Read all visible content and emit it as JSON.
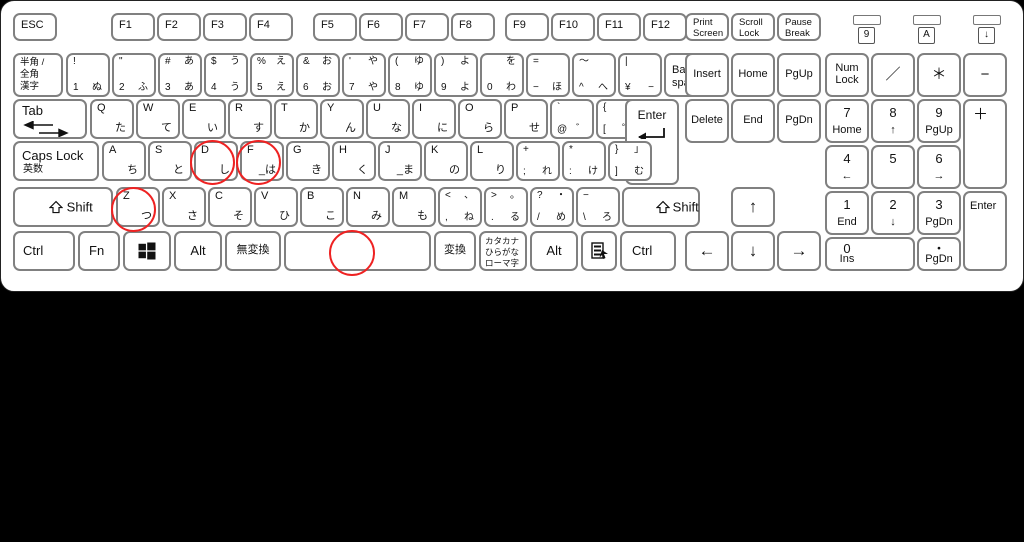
{
  "keyboard": {
    "layout_name": "Japanese JIS 109-key full-size keyboard",
    "highlight_color": "#ee2222",
    "case_color": "#ffffff",
    "key_border_color": "#808080",
    "background_color": "#000000"
  },
  "indicators": [
    {
      "name": "num-lock-led",
      "glyph": "9"
    },
    {
      "name": "caps-lock-led",
      "glyph": "A"
    },
    {
      "name": "scroll-lock-led",
      "glyph": "↓"
    }
  ],
  "function_row": {
    "esc": "ESC",
    "f_keys": [
      "F1",
      "F2",
      "F3",
      "F4",
      "F5",
      "F6",
      "F7",
      "F8",
      "F9",
      "F10",
      "F11",
      "F12"
    ],
    "print_screen": [
      "Print",
      "Screen"
    ],
    "scroll_lock": [
      "Scroll",
      "Lock"
    ],
    "pause_break": [
      "Pause",
      "Break"
    ]
  },
  "number_row": [
    {
      "name": "hankaku-zenkaku",
      "lines": [
        "半角 /",
        "全角",
        "漢字"
      ]
    },
    {
      "name": "key-1",
      "tl": "!",
      "tr": "",
      "bl": "1",
      "br": "ぬ"
    },
    {
      "name": "key-2",
      "tl": "\"",
      "tr": "",
      "bl": "2",
      "br": "ふ"
    },
    {
      "name": "key-3",
      "tl": "#",
      "tr": "あ",
      "bl": "3",
      "br": "あ"
    },
    {
      "name": "key-4",
      "tl": "$",
      "tr": "う",
      "bl": "4",
      "br": "う"
    },
    {
      "name": "key-5",
      "tl": "%",
      "tr": "え",
      "bl": "5",
      "br": "え"
    },
    {
      "name": "key-6",
      "tl": "&",
      "tr": "お",
      "bl": "6",
      "br": "お"
    },
    {
      "name": "key-7",
      "tl": "'",
      "tr": "や",
      "bl": "7",
      "br": "や"
    },
    {
      "name": "key-8",
      "tl": "(",
      "tr": "ゆ",
      "bl": "8",
      "br": "ゆ"
    },
    {
      "name": "key-9",
      "tl": ")",
      "tr": "よ",
      "bl": "9",
      "br": "よ"
    },
    {
      "name": "key-0",
      "tl": "",
      "tr": "を",
      "bl": "0",
      "br": "わ"
    },
    {
      "name": "key-minus",
      "tl": "=",
      "tr": "",
      "bl": "−",
      "br": "ほ"
    },
    {
      "name": "key-caret",
      "tl": "～",
      "tr": "",
      "bl": "^",
      "br": "へ"
    },
    {
      "name": "key-yen",
      "tl": "|",
      "tr": "",
      "bl": "¥",
      "br": "−"
    },
    {
      "name": "backspace",
      "lines": [
        "Back",
        "space"
      ]
    }
  ],
  "qwerty_row": {
    "tab": "Tab",
    "keys": [
      {
        "name": "key-q",
        "latin": "Q",
        "kana": "た"
      },
      {
        "name": "key-w",
        "latin": "W",
        "kana": "て"
      },
      {
        "name": "key-e",
        "latin": "E",
        "kana": "い"
      },
      {
        "name": "key-r",
        "latin": "R",
        "kana": "す"
      },
      {
        "name": "key-t",
        "latin": "T",
        "kana": "か"
      },
      {
        "name": "key-y",
        "latin": "Y",
        "kana": "ん"
      },
      {
        "name": "key-u",
        "latin": "U",
        "kana": "な"
      },
      {
        "name": "key-i",
        "latin": "I",
        "kana": "に"
      },
      {
        "name": "key-o",
        "latin": "O",
        "kana": "ら"
      },
      {
        "name": "key-p",
        "latin": "P",
        "kana": "せ"
      }
    ],
    "at_key": {
      "name": "key-at",
      "tl": "`",
      "tr": "",
      "bl": "@",
      "br": "゛"
    },
    "bracket_key": {
      "name": "key-bracket-left",
      "tl": "{",
      "tr": "「",
      "bl": "[",
      "br": "゜"
    },
    "enter": "Enter"
  },
  "home_row": {
    "caps_lock": {
      "line1": "Caps Lock",
      "line2": "英数"
    },
    "keys": [
      {
        "name": "key-a",
        "latin": "A",
        "kana": "ち"
      },
      {
        "name": "key-s",
        "latin": "S",
        "kana": "と"
      },
      {
        "name": "key-d",
        "latin": "D",
        "kana": "し",
        "highlighted": true
      },
      {
        "name": "key-f",
        "latin": "F",
        "kana": "_は",
        "highlighted": true
      },
      {
        "name": "key-g",
        "latin": "G",
        "kana": "き"
      },
      {
        "name": "key-h",
        "latin": "H",
        "kana": "く"
      },
      {
        "name": "key-j",
        "latin": "J",
        "kana": "_ま"
      },
      {
        "name": "key-k",
        "latin": "K",
        "kana": "の"
      },
      {
        "name": "key-l",
        "latin": "L",
        "kana": "り"
      }
    ],
    "semicolon": {
      "name": "key-semicolon",
      "tl": "+",
      "tr": "",
      "bl": ";",
      "br": "れ"
    },
    "colon": {
      "name": "key-colon",
      "tl": "*",
      "tr": "",
      "bl": ":",
      "br": "け"
    },
    "bracket_right": {
      "name": "key-bracket-right",
      "tl": "}",
      "tr": "」",
      "bl": "]",
      "br": "む"
    }
  },
  "shift_row": {
    "left_shift": "Shift",
    "right_shift": "Shift",
    "keys": [
      {
        "name": "key-z",
        "latin": "Z",
        "kana": "つ",
        "highlighted": true
      },
      {
        "name": "key-x",
        "latin": "X",
        "kana": "さ"
      },
      {
        "name": "key-c",
        "latin": "C",
        "kana": "そ"
      },
      {
        "name": "key-v",
        "latin": "V",
        "kana": "ひ"
      },
      {
        "name": "key-b",
        "latin": "B",
        "kana": "こ"
      },
      {
        "name": "key-n",
        "latin": "N",
        "kana": "み"
      },
      {
        "name": "key-m",
        "latin": "M",
        "kana": "も"
      }
    ],
    "comma": {
      "name": "key-comma",
      "tl": "<",
      "tr": "、",
      "bl": ",",
      "br": "ね"
    },
    "period": {
      "name": "key-period",
      "tl": ">",
      "tr": "。",
      "bl": ".",
      "br": "る"
    },
    "slash": {
      "name": "key-slash",
      "tl": "?",
      "tr": "・",
      "bl": "/",
      "br": "め"
    },
    "backslash": {
      "name": "key-backslash",
      "tl": "−",
      "tr": "",
      "bl": "\\",
      "br": "ろ"
    }
  },
  "bottom_row": {
    "ctrl_left": "Ctrl",
    "fn": "Fn",
    "win": "windows-key",
    "alt_left": "Alt",
    "muhenkan": "無変換",
    "space": "",
    "henkan": "変換",
    "katakana": [
      "カタカナ",
      "ひらがな",
      "ローマ字"
    ],
    "alt_right": "Alt",
    "menu": "menu-key",
    "ctrl_right": "Ctrl",
    "space_highlighted": true
  },
  "nav_cluster": {
    "insert": "Insert",
    "home": "Home",
    "pgup": "PgUp",
    "delete": "Delete",
    "end": "End",
    "pgdn": "PgDn",
    "arrow_up": "↑",
    "arrow_left": "←",
    "arrow_down": "↓",
    "arrow_right": "→"
  },
  "numpad": {
    "num_lock": [
      "Num",
      "Lock"
    ],
    "divide": "／",
    "multiply": "＊",
    "minus": "−",
    "plus": "＋",
    "enter": "Enter",
    "keys": [
      {
        "name": "numpad-7",
        "num": "7",
        "sub": "Home"
      },
      {
        "name": "numpad-8",
        "num": "8",
        "sub": "↑"
      },
      {
        "name": "numpad-9",
        "num": "9",
        "sub": "PgUp"
      },
      {
        "name": "numpad-4",
        "num": "4",
        "sub": "←"
      },
      {
        "name": "numpad-5",
        "num": "5",
        "sub": ""
      },
      {
        "name": "numpad-6",
        "num": "6",
        "sub": "→"
      },
      {
        "name": "numpad-1",
        "num": "1",
        "sub": "End"
      },
      {
        "name": "numpad-2",
        "num": "2",
        "sub": "↓"
      },
      {
        "name": "numpad-3",
        "num": "3",
        "sub": "PgDn"
      },
      {
        "name": "numpad-0",
        "num": "0",
        "sub": "Ins"
      },
      {
        "name": "numpad-decimal",
        "num": "・",
        "sub": "PgDn"
      }
    ]
  },
  "annotations": {
    "circled_keys": [
      "key-d",
      "key-f",
      "key-z",
      "space-bar"
    ],
    "circle_color": "#ee2222"
  }
}
